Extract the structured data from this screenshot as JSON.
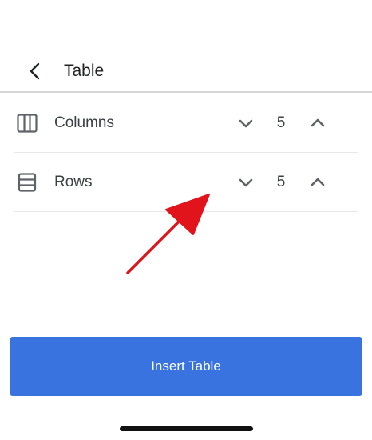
{
  "header": {
    "title": "Table"
  },
  "rows": [
    {
      "label": "Columns",
      "value": "5",
      "icon": "columns-icon"
    },
    {
      "label": "Rows",
      "value": "5",
      "icon": "rows-icon"
    }
  ],
  "insert_button": {
    "label": "Insert Table"
  },
  "colors": {
    "primary": "#3873e0",
    "annotation_arrow": "#e0141a",
    "icon": "#5f6368",
    "divider": "#d6d6d6"
  }
}
